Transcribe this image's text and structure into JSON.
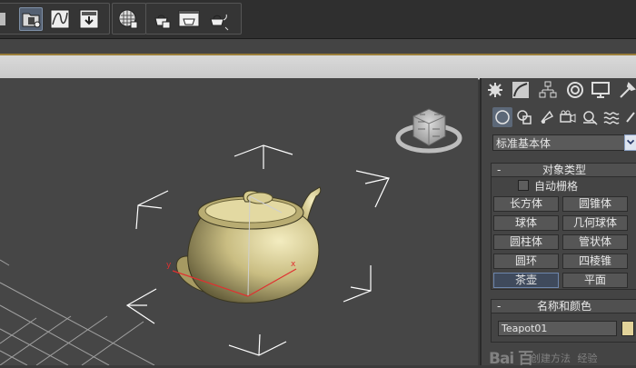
{
  "toolbar": {
    "buttons": [
      {
        "name": "open-file-icon"
      },
      {
        "name": "schematic-view-icon"
      },
      {
        "name": "curve-editor-icon"
      },
      {
        "name": "render-frame-icon"
      },
      {
        "name": "material-editor-icon"
      },
      {
        "name": "render-setup-icon"
      },
      {
        "name": "render-frame-window-icon"
      },
      {
        "name": "quick-render-icon"
      }
    ]
  },
  "command_panel": {
    "tabs": [
      "create-tab-icon",
      "modify-tab-icon",
      "hierarchy-tab-icon",
      "motion-tab-icon",
      "display-tab-icon",
      "utilities-tab-icon"
    ],
    "subtabs": [
      "geometry-icon",
      "shapes-icon",
      "lights-icon",
      "cameras-icon",
      "helpers-icon",
      "space-warps-icon",
      "systems-icon"
    ],
    "category": "标准基本体",
    "object_type": {
      "title": "对象类型",
      "auto_grid": "自动栅格",
      "buttons": [
        "长方体",
        "圆锥体",
        "球体",
        "几何球体",
        "圆柱体",
        "管状体",
        "圆环",
        "四棱锥",
        "茶壶",
        "平面"
      ],
      "selected": "茶壶"
    },
    "name_color": {
      "title": "名称和颜色",
      "name_value": "Teapot01",
      "color": "#e2d39a"
    },
    "next_rollout_partial": "创建方法"
  },
  "viewport": {
    "gizmo_labels": {
      "x": "x",
      "y": "y"
    },
    "colors": {
      "background": "#464646",
      "teapot": "#c9bd82",
      "grid": "#9a9a9a",
      "bracket": "#ffffff"
    }
  },
  "watermark": {
    "logo": "Bai 百",
    "text": "经验"
  },
  "minus": "-"
}
